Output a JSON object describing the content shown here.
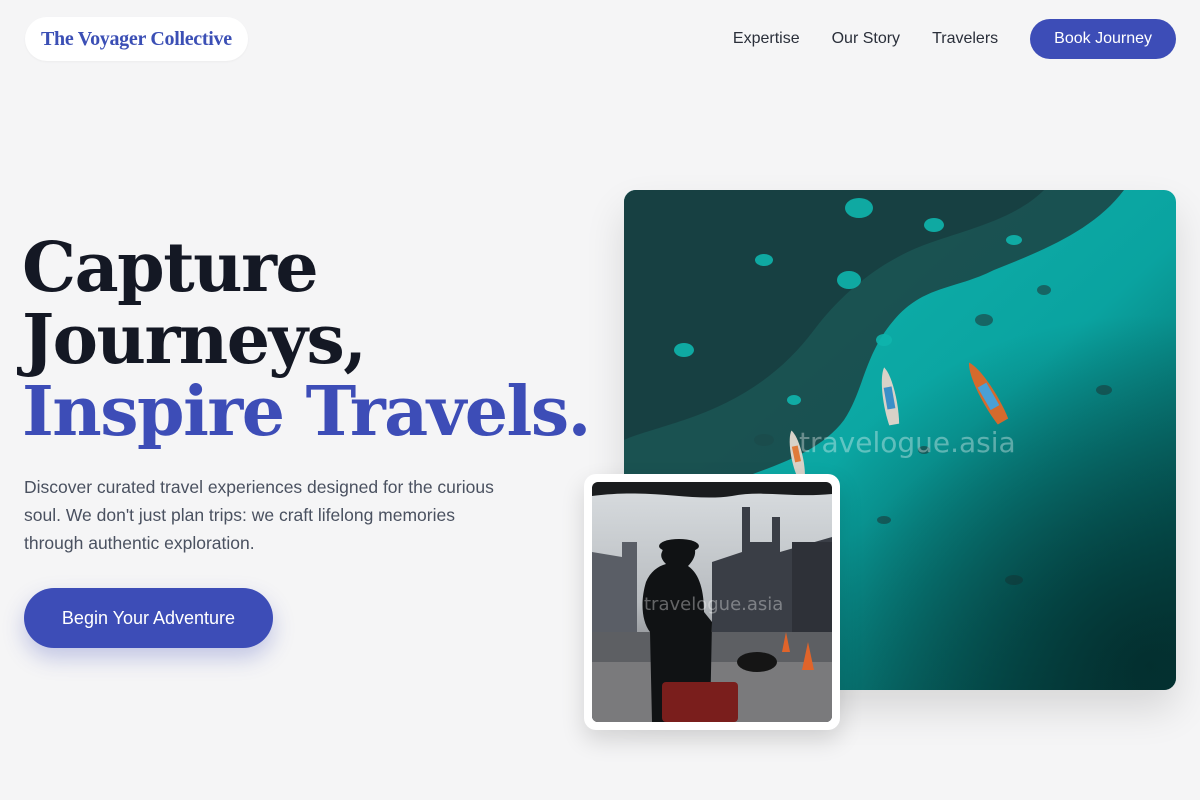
{
  "header": {
    "logo_text": "The Voyager Collective",
    "nav": {
      "expertise": "Expertise",
      "our_story": "Our Story",
      "travelers": "Travelers",
      "book_label": "Book Journey"
    }
  },
  "hero": {
    "headline_line1": "Capture",
    "headline_line2": "Journeys,",
    "headline_line3": "Inspire Travels.",
    "subcopy": "Discover curated travel experiences designed for the curious soul. We don't just plan trips: we craft lifelong memories through authentic exploration.",
    "cta_label": "Begin Your Adventure"
  },
  "images": {
    "main_watermark": "travelogue.asia",
    "inset_watermark": "travelogue.asia"
  },
  "colors": {
    "accent": "#3d4db7",
    "background": "#f5f5f6",
    "headline": "#141824",
    "body_text": "#4a5160"
  },
  "icons": [
    "aerial-sea-photo",
    "traveler-photo"
  ]
}
